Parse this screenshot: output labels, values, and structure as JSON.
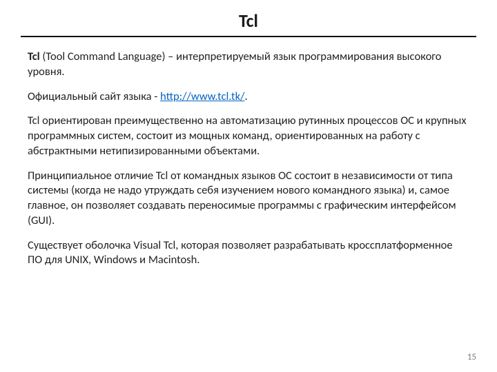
{
  "title": "Tcl",
  "p1": {
    "bold": "Tcl",
    "rest": " (Tool Command Language) –  интерпретируемый язык программирования высокого уровня."
  },
  "p2": {
    "before": "Официальный сайт языка - ",
    "link_text": "http://www.tcl.tk/",
    "link_href": "http://www.tcl.tk/",
    "after": "."
  },
  "p3": "Tcl ориентирован преимущественно на автоматизацию рутинных процессов ОС и крупных программных систем, состоит из мощных команд, ориентированных на работу с абстрактными нетипизированными объектами.",
  "p4": "Принципиальное отличие Tcl от командных языков ОС состоит в независимости от типа системы (когда не надо утруждать себя изучением нового командного языка) и, самое главное, он позволяет создавать переносимые программы с графическим интерфейсом (GUI).",
  "p5": "Существует оболочка Visual Tcl, которая позволяет разрабатывать кроссплатформенное ПО для UNIX, Windows и Macintosh.",
  "page_number": "15"
}
